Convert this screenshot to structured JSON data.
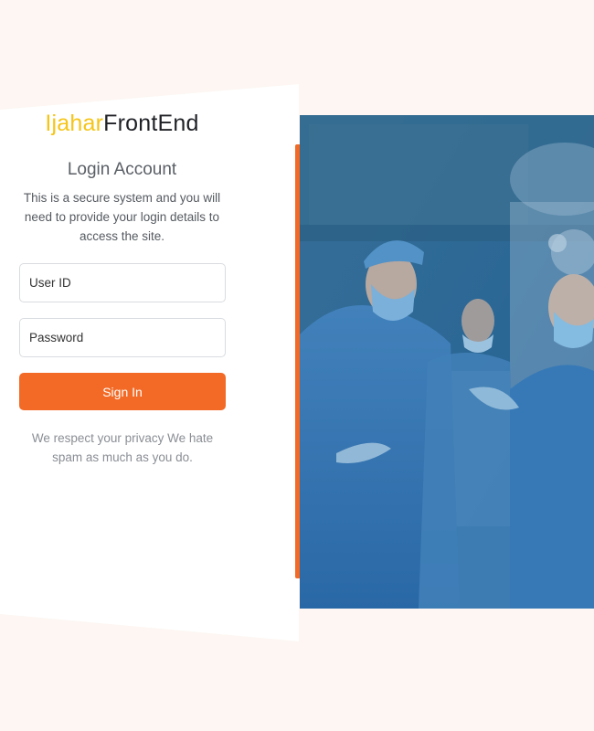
{
  "brand": {
    "part1": "Ijahar",
    "part2": "FrontEnd"
  },
  "login": {
    "title": "Login Account",
    "description": "This is a secure system and you will need to provide your login details to access the site.",
    "userid_placeholder": "User ID",
    "password_placeholder": "Password",
    "signin_label": "Sign In",
    "privacy_note": "We respect your privacy We hate spam as much as you do."
  },
  "colors": {
    "accent": "#f26a25",
    "brand_yellow": "#f5c518",
    "brand_dark": "#1f2126",
    "hero_tint": "#2f6a94"
  },
  "hero": {
    "icon": "surgeons-photo-with-medical-cross"
  }
}
